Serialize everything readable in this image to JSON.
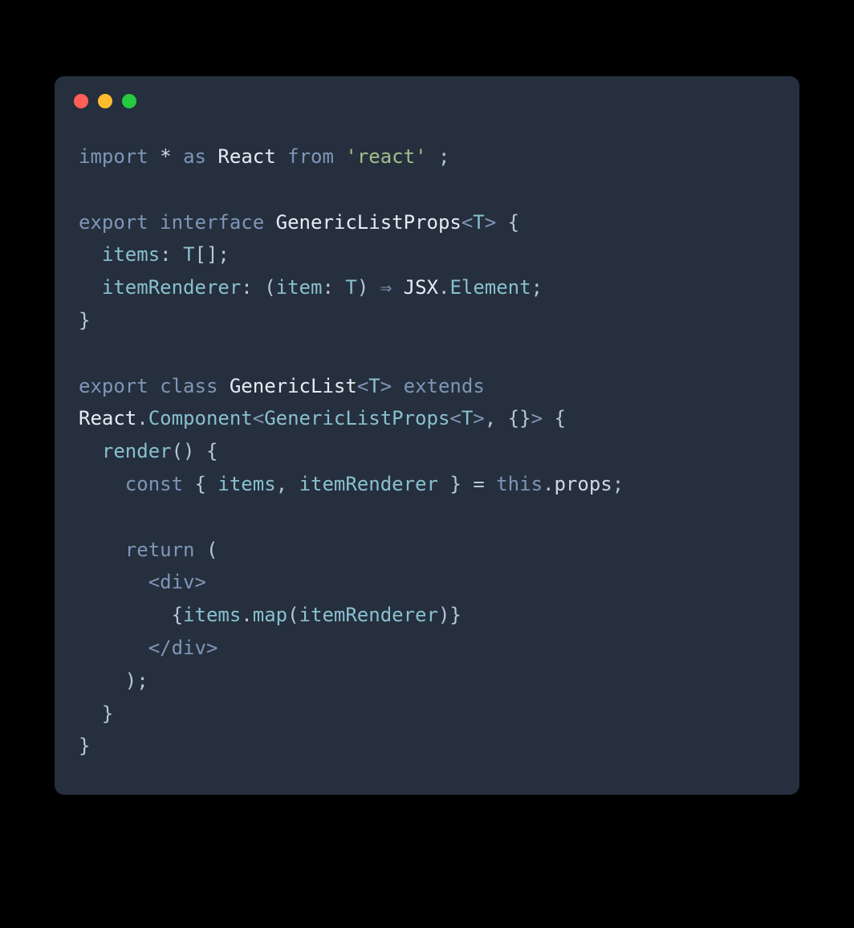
{
  "editor": {
    "buttons": {
      "close": "",
      "min": "",
      "max": ""
    }
  },
  "code": {
    "l1": {
      "kw_import": "import",
      "star": "*",
      "kw_as": "as",
      "react": "React",
      "kw_from": "from",
      "str_react": "'react'",
      "semi": ";"
    },
    "l3": {
      "kw_export": "export",
      "kw_interface": "interface",
      "name": "GenericListProps",
      "lt": "<",
      "T": "T",
      "gt": ">",
      "brace": "{"
    },
    "l4": {
      "items": "items",
      "colon": ":",
      "T": "T",
      "arr": "[];"
    },
    "l5": {
      "itemRenderer": "itemRenderer",
      "colon": ":",
      "lp": "(",
      "item": "item",
      "colon2": ":",
      "T": "T",
      "rp": ")",
      "arrow": "⇒",
      "JSX": "JSX",
      "dot": ".",
      "Element": "Element",
      "semi": ";"
    },
    "l6": {
      "brace": "}"
    },
    "l8": {
      "kw_export": "export",
      "kw_class": "class",
      "name": "GenericList",
      "lt": "<",
      "T": "T",
      "gt": ">",
      "kw_extends": "extends"
    },
    "l9": {
      "React": "React",
      "dot": ".",
      "Component": "Component",
      "lt": "<",
      "GLP": "GenericListProps",
      "lt2": "<",
      "T": "T",
      "gt2": ">",
      "comma": ",",
      "empty": "{}",
      "gt": ">",
      "brace": "{"
    },
    "l10": {
      "render": "render",
      "parens": "()",
      "brace": "{"
    },
    "l11": {
      "kw_const": "const",
      "lb": "{",
      "items": "items",
      "comma": ",",
      "itemRenderer": "itemRenderer",
      "rb": "}",
      "eq": "=",
      "kw_this": "this",
      "dot": ".",
      "props": "props",
      "semi": ";"
    },
    "l13": {
      "kw_return": "return",
      "lp": "("
    },
    "l14": {
      "open": "<",
      "div": "div",
      "close": ">"
    },
    "l15": {
      "lb": "{",
      "items": "items",
      "dot": ".",
      "map": "map",
      "lp": "(",
      "itemRenderer": "itemRenderer",
      "rp": ")",
      "rb": "}"
    },
    "l16": {
      "open": "</",
      "div": "div",
      "close": ">"
    },
    "l17": {
      "rp": ");"
    },
    "l18": {
      "rb": "}"
    },
    "l19": {
      "rb": "}"
    }
  }
}
